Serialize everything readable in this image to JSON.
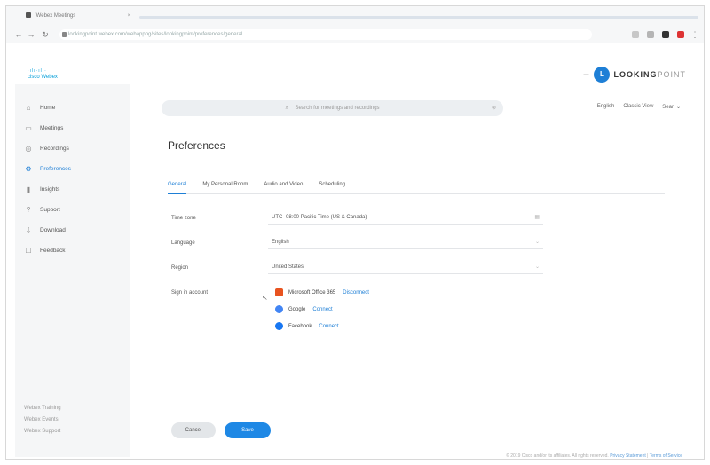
{
  "browser": {
    "tab_title": "Webex Meetings",
    "url": "lookingpoint.webex.com/webappng/sites/lookingpoint/preferences/general"
  },
  "header": {
    "brand_small": "cisco",
    "brand_product": "Webex",
    "partner_prefix": "—",
    "partner_logo_letter": "L",
    "partner_name": "LOOKING",
    "partner_name_tail": "POINT"
  },
  "sidebar": {
    "items": [
      {
        "label": "Home",
        "icon": "home-icon"
      },
      {
        "label": "Meetings",
        "icon": "calendar-icon"
      },
      {
        "label": "Recordings",
        "icon": "recordings-icon"
      },
      {
        "label": "Preferences",
        "icon": "gear-icon",
        "active": true
      },
      {
        "label": "Insights",
        "icon": "chart-icon"
      },
      {
        "label": "Support",
        "icon": "help-icon"
      },
      {
        "label": "Download",
        "icon": "download-icon"
      },
      {
        "label": "Feedback",
        "icon": "feedback-icon"
      }
    ],
    "footer": [
      "Webex Training",
      "Webex Events",
      "Webex Support"
    ]
  },
  "search": {
    "placeholder": "Search for meetings and recordings"
  },
  "topbar": {
    "language": "English",
    "classic_view": "Classic View",
    "user": "Sean ⌄"
  },
  "page": {
    "title": "Preferences",
    "tabs": [
      "General",
      "My Personal Room",
      "Audio and Video",
      "Scheduling"
    ],
    "active_tab": "General"
  },
  "form": {
    "time_zone_label": "Time zone",
    "time_zone_value": "UTC -08:00 Pacific Time (US & Canada)",
    "language_label": "Language",
    "language_value": "English",
    "region_label": "Region",
    "region_value": "United States",
    "sign_in_label": "Sign in account",
    "accounts": [
      {
        "name": "Microsoft Office 365",
        "action": "Disconnect",
        "color": "#e8531f"
      },
      {
        "name": "Google",
        "action": "Connect",
        "color": "#4285f4"
      },
      {
        "name": "Facebook",
        "action": "Connect",
        "color": "#1877f2"
      }
    ]
  },
  "buttons": {
    "cancel": "Cancel",
    "save": "Save"
  },
  "footer": {
    "copyright": "© 2019 Cisco and/or its affiliates. All rights reserved.",
    "privacy": "Privacy Statement",
    "terms": "Terms of Service"
  },
  "colors": {
    "accent": "#1e7fd6",
    "sidebar_bg": "#f5f6f7"
  }
}
